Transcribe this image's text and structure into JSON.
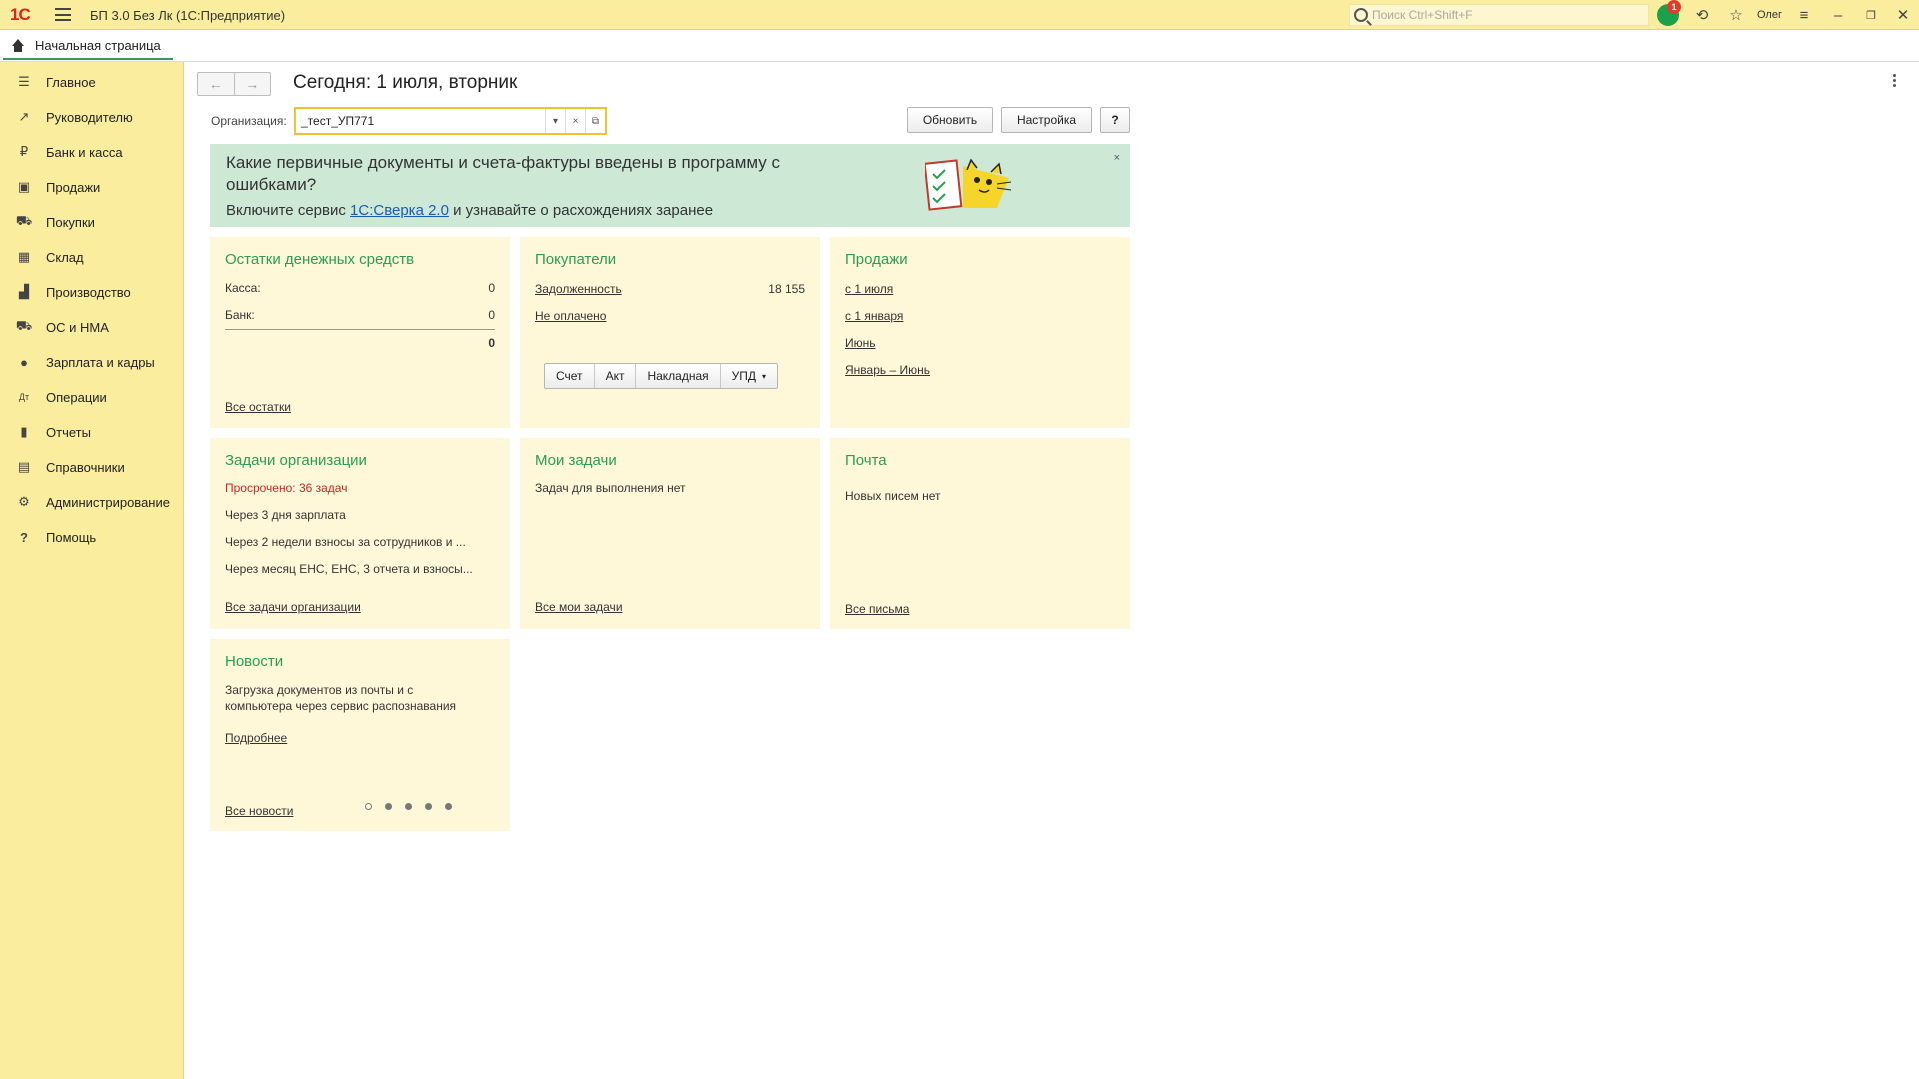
{
  "titlebar": {
    "logo": "1С",
    "title": "БП 3.0 Без Лк  (1С:Предприятие)",
    "search_placeholder": "Поиск Ctrl+Shift+F",
    "notifications_count": "1",
    "user": "Олег"
  },
  "tabs": {
    "home_label": "Начальная страница"
  },
  "sidebar": {
    "items": [
      {
        "label": "Главное",
        "icon": "menu-icon",
        "glyph": "☰"
      },
      {
        "label": "Руководителю",
        "icon": "trend-icon",
        "glyph": "↗"
      },
      {
        "label": "Банк и касса",
        "icon": "ruble-icon",
        "glyph": "₽"
      },
      {
        "label": "Продажи",
        "icon": "bag-icon",
        "glyph": "▣"
      },
      {
        "label": "Покупки",
        "icon": "cart-icon",
        "glyph": "⛟"
      },
      {
        "label": "Склад",
        "icon": "warehouse-icon",
        "glyph": "▦"
      },
      {
        "label": "Производство",
        "icon": "factory-icon",
        "glyph": "▟"
      },
      {
        "label": "ОС и НМА",
        "icon": "truck-icon",
        "glyph": "⛟"
      },
      {
        "label": "Зарплата и кадры",
        "icon": "person-icon",
        "glyph": "●"
      },
      {
        "label": "Операции",
        "icon": "dt-kt-icon",
        "glyph": "Дт"
      },
      {
        "label": "Отчеты",
        "icon": "bar-chart-icon",
        "glyph": "▮"
      },
      {
        "label": "Справочники",
        "icon": "books-icon",
        "glyph": "▤"
      },
      {
        "label": "Администрирование",
        "icon": "gear-icon",
        "glyph": "⚙"
      },
      {
        "label": "Помощь",
        "icon": "question-icon",
        "glyph": "?"
      }
    ]
  },
  "main": {
    "title": "Сегодня: 1 июля, вторник",
    "org_label": "Организация:",
    "org_value": "_тест_УП771",
    "refresh_label": "Обновить",
    "settings_label": "Настройка",
    "help_label": "?"
  },
  "banner": {
    "question": "Какие первичные документы и счета-фактуры введены в программу с ошибками?",
    "prefix": "Включите сервис ",
    "link": "1С:Сверка 2.0",
    "suffix": " и узнавайте о расхождениях заранее",
    "close": "×"
  },
  "cards": {
    "cash": {
      "title": "Остатки денежных средств",
      "kassa_label": "Касса:",
      "kassa_value": "0",
      "bank_label": "Банк:",
      "bank_value": "0",
      "total_value": "0",
      "link": "Все остатки"
    },
    "buyers": {
      "title": "Покупатели",
      "debt_link": "Задолженность",
      "debt_value": "18 155",
      "unpaid_link": "Не оплачено",
      "btn_invoice": "Счет",
      "btn_act": "Акт",
      "btn_waybill": "Накладная",
      "btn_upd": "УПД"
    },
    "sales": {
      "title": "Продажи",
      "links": [
        "с 1 июля",
        "с 1 января",
        "Июнь",
        "Январь – Июнь"
      ]
    },
    "org_tasks": {
      "title": "Задачи организации",
      "overdue": "Просрочено: 36 задач",
      "t1": "Через 3 дня зарплата",
      "t2": "Через 2 недели взносы за сотрудников и ...",
      "t3": "Через месяц ЕНС, ЕНС, 3 отчета и взносы...",
      "link": "Все задачи организации"
    },
    "my_tasks": {
      "title": "Мои задачи",
      "text": "Задач для выполнения нет",
      "link": "Все мои задачи"
    },
    "mail": {
      "title": "Почта",
      "text": "Новых писем нет",
      "link": "Все письма"
    },
    "news": {
      "title": "Новости",
      "text1": "Загрузка документов из почты и с",
      "text2": "компьютера через сервис распознавания",
      "more": "Подробнее",
      "link": "Все новости"
    }
  },
  "colors": {
    "sidebar": "#fbed9e",
    "card": "#fff8d8",
    "banner": "#cde9d6",
    "accent": "#2a9d52",
    "link": "#1a5bb8",
    "danger": "#c62828"
  }
}
